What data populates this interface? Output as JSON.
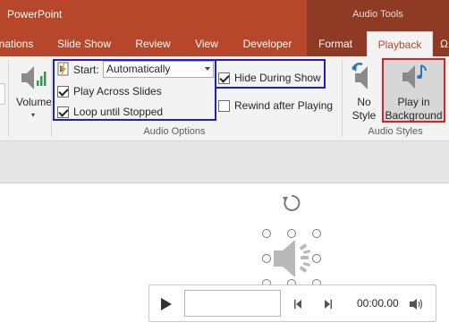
{
  "app": {
    "title": "PowerPoint"
  },
  "context_tab_group": {
    "title": "Audio Tools"
  },
  "tabs": [
    {
      "label": "nations"
    },
    {
      "label": "Slide Show"
    },
    {
      "label": "Review"
    },
    {
      "label": "View"
    },
    {
      "label": "Developer"
    },
    {
      "label": "Format"
    },
    {
      "label": "Playback",
      "active": true
    }
  ],
  "ribbon": {
    "volume": {
      "label": "Volume"
    },
    "audio_options": {
      "start_label": "Start:",
      "start_value": "Automatically",
      "play_across_slides": {
        "label": "Play Across Slides",
        "checked": true
      },
      "loop_until_stopped": {
        "label": "Loop until Stopped",
        "checked": true
      },
      "hide_during_show": {
        "label": "Hide During Show",
        "checked": true
      },
      "rewind_after_playing": {
        "label": "Rewind after Playing",
        "checked": false
      },
      "group_label": "Audio Options"
    },
    "audio_styles": {
      "no_style": {
        "line1": "No",
        "line2": "Style"
      },
      "play_in_background": {
        "line1": "Play in",
        "line2": "Background"
      },
      "group_label": "Audio Styles"
    }
  },
  "player": {
    "time": "00:00.00"
  },
  "colors": {
    "accent": "#b7472a",
    "context": "#8e3a24",
    "highlight_blue": "#1f1fc8",
    "highlight_red": "#e02020"
  }
}
